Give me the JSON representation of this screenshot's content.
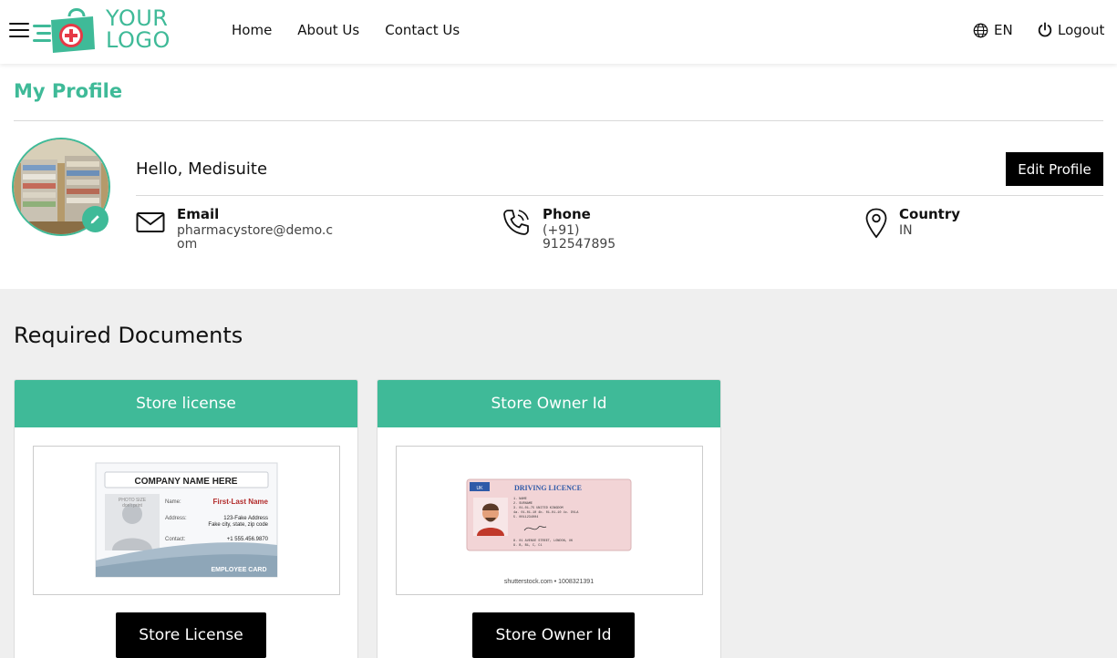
{
  "header": {
    "logo_line1": "YOUR",
    "logo_line2": "LOGO",
    "nav": [
      "Home",
      "About Us",
      "Contact Us"
    ],
    "language": "EN",
    "logout": "Logout"
  },
  "profile": {
    "title": "My Profile",
    "greeting": "Hello, Medisuite",
    "edit_label": "Edit Profile",
    "email_label": "Email",
    "email_line1": "pharmacystore@demo.c",
    "email_line2": "om",
    "phone_label": "Phone",
    "phone_value": "(+91) 912547895",
    "country_label": "Country",
    "country_value": "IN"
  },
  "documents": {
    "title": "Required Documents",
    "cards": [
      {
        "header": "Store license",
        "button": "Store License",
        "id_card": {
          "company": "COMPANY NAME HERE",
          "photo_line1": "PHOTO SIZE",
          "photo_line2": "don't print",
          "name_label": "Name:",
          "name_value": "First-Last Name",
          "address_label": "Address:",
          "address_line1": "123-Fake Address",
          "address_line2": "Fake city, state, zip code",
          "contact_label": "Contact:",
          "contact_value": "+1 555.456.9870",
          "footer": "EMPLOYEE CARD"
        }
      },
      {
        "header": "Store Owner Id",
        "button": "Store Owner Id",
        "licence": {
          "country": "UK",
          "title": "DRIVING LICENCE",
          "l1": "1.  NAME",
          "l2": "2.  SURNAME",
          "l3": "3.  01-01-75 UNITED KINGDOM",
          "l4": "4a. 01-01-10    4b. 01-01-10    4c. DVLA",
          "l5": "5.  0011234004",
          "l6": "8.  01 AVENUE STREET, LONDON, UK",
          "l7": "9.  B, B1, C, C1",
          "watermark": "shutterstock.com • 1008321391"
        }
      }
    ]
  },
  "colors": {
    "accent": "#3fba98",
    "dark": "#000000",
    "grey_bg": "#efefef"
  }
}
